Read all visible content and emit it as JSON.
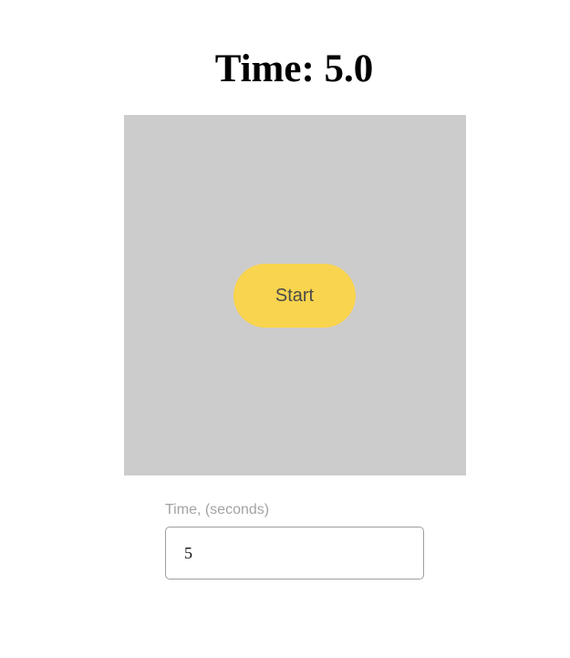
{
  "header": {
    "title": "Time: 5.0"
  },
  "game": {
    "start_label": "Start",
    "colors": {
      "area_background": "#cccccc",
      "button_background": "#f9d44e"
    }
  },
  "settings": {
    "time_label": "Time, (seconds)",
    "time_value": "5"
  }
}
